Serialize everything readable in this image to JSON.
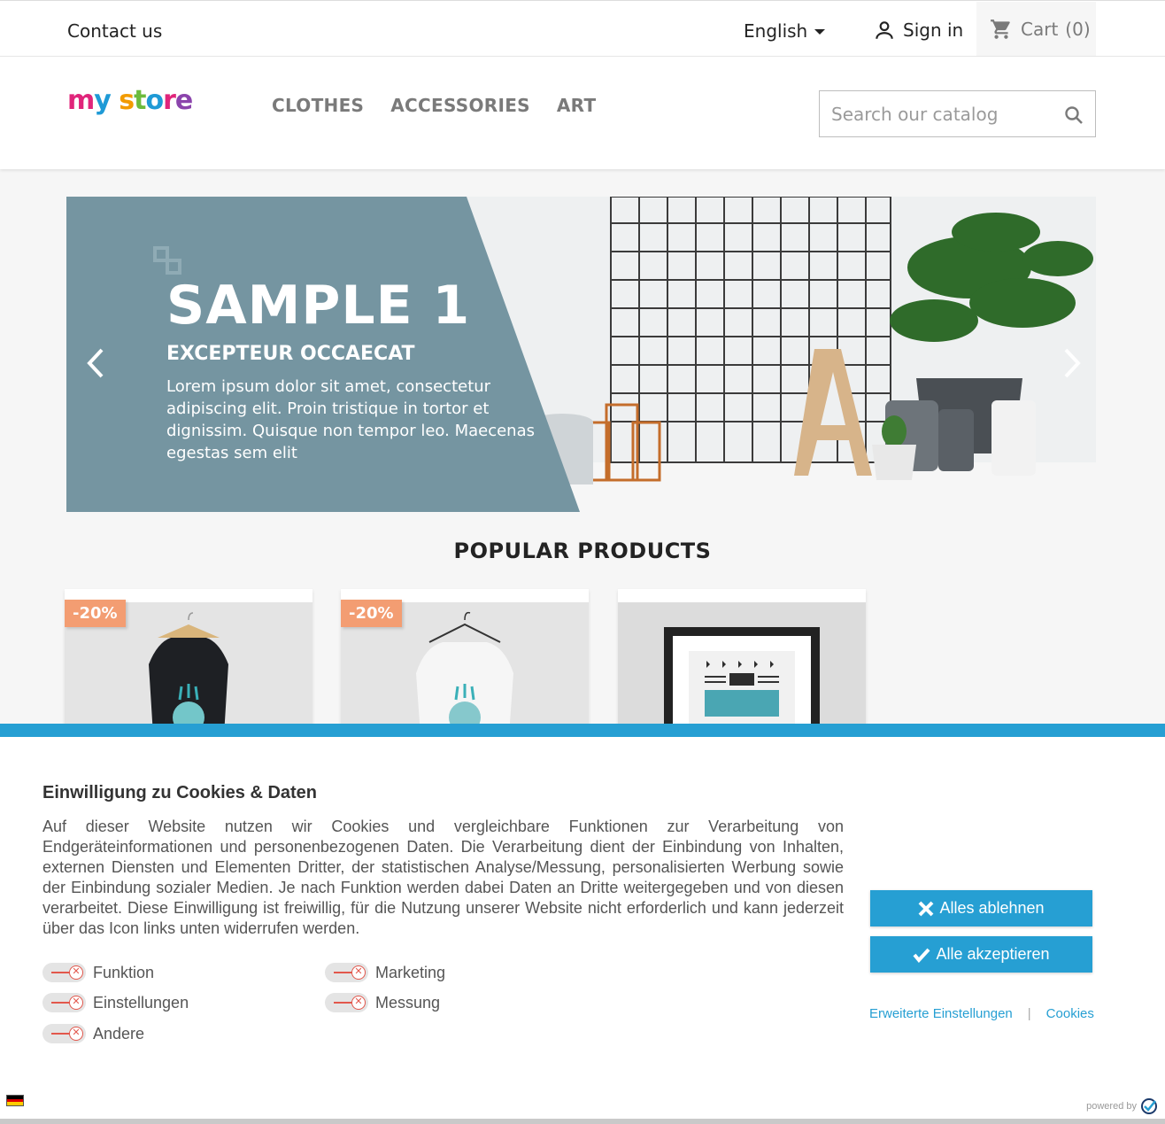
{
  "topbar": {
    "contact": "Contact us",
    "language": "English",
    "signin": "Sign in",
    "cart": "Cart",
    "cart_count": "(0)"
  },
  "header": {
    "logo": "my store",
    "nav": [
      "CLOTHES",
      "ACCESSORIES",
      "ART"
    ],
    "search_placeholder": "Search our catalog"
  },
  "banner": {
    "title": "SAMPLE 1",
    "subtitle": "EXCEPTEUR OCCAECAT",
    "text": "Lorem ipsum dolor sit amet, consectetur adipiscing elit. Proin tristique in tortor et dignissim. Quisque non tempor leo. Maecenas egestas sem elit"
  },
  "popular": {
    "title": "POPULAR PRODUCTS",
    "products": [
      {
        "discount": "-20%"
      },
      {
        "discount": "-20%"
      },
      {
        "discount": ""
      }
    ]
  },
  "cookie": {
    "title": "Einwilligung zu Cookies & Daten",
    "text": "Auf dieser Website nutzen wir Cookies und vergleichbare Funktionen zur Verarbeitung von Endgeräteinformationen und personenbezogenen Daten. Die Verarbeitung dient der Einbindung von Inhalten, externen Diensten und Elementen Dritter, der statistischen Analyse/Messung, personalisierten Werbung sowie der Einbindung sozialer Medien. Je nach Funktion werden dabei Daten an Dritte weitergegeben und von diesen verarbeitet. Diese Einwilligung ist freiwillig, für die Nutzung unserer Website nicht erforderlich und kann jederzeit über das Icon links unten widerrufen werden.",
    "toggles": [
      "Funktion",
      "Marketing",
      "Einstellungen",
      "Messung",
      "Andere"
    ],
    "reject": "Alles ablehnen",
    "accept": "Alle akzeptieren",
    "advanced": "Erweiterte Einstellungen",
    "separator": "|",
    "cookies": "Cookies",
    "powered": "powered by"
  },
  "colors": {
    "accent": "#269fd3",
    "discount": "#f39d72",
    "banner_panel": "#7595a1"
  }
}
